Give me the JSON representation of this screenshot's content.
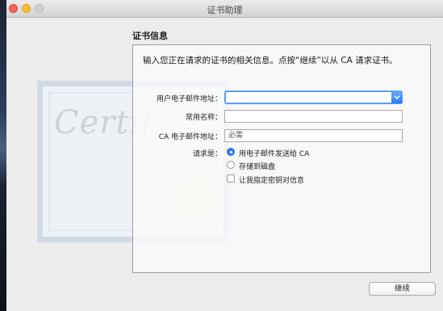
{
  "window": {
    "title": "证书助理"
  },
  "section": {
    "title": "证书信息",
    "instructions": "输入您正在请求的证书的相关信息。点按“继续”以从 CA 请求证书。"
  },
  "form": {
    "email_label": "用户电子邮件地址：",
    "email_value": "",
    "common_name_label": "常用名称：",
    "common_name_value": "",
    "ca_email_label": "CA 电子邮件地址：",
    "ca_email_value": "必需",
    "request_label": "请求是：",
    "options": [
      {
        "label": "用电子邮件发送给 CA",
        "selected": true
      },
      {
        "label": "存储到磁盘",
        "selected": false
      }
    ],
    "checkbox_label": "让我指定密钥对信息",
    "checkbox_checked": false
  },
  "buttons": {
    "continue": "继续"
  },
  "decoration": {
    "certificate_script": "Certif"
  },
  "colors": {
    "accent": "#2f7ef4",
    "close": "#fc5f57",
    "minimize": "#fdbc2e"
  }
}
